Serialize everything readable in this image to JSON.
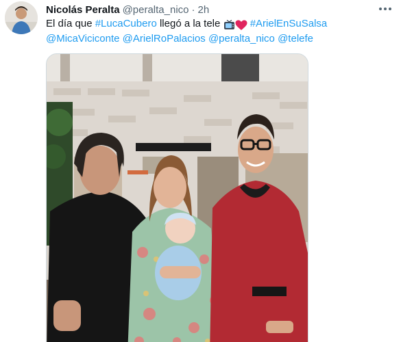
{
  "tweet": {
    "author": {
      "display_name": "Nicolás Peralta",
      "handle": "@peralta_nico",
      "avatar_icon": "avatar-icon"
    },
    "separator": "·",
    "time": "2h",
    "more_icon": "more-icon",
    "text": {
      "line1": {
        "prefix": "El día que ",
        "hashtag1": "#LucaCubero",
        "middle": " llegó a la tele ",
        "emoji_tv": "tv-emoji-icon",
        "emoji_heart": "red-heart-emoji-icon",
        "hashtag2": "#ArielEnSuSalsa"
      },
      "line2": {
        "mention1": "@MicaViciconte",
        "mention2": "@ArielRoPalacios",
        "mention3": "@peralta_nico",
        "mention4": "@telefe"
      }
    },
    "media": {
      "type": "photo"
    }
  },
  "colors": {
    "text": "#0f1419",
    "secondary": "#536471",
    "link": "#1d9bf0",
    "border": "#cfd9de"
  }
}
